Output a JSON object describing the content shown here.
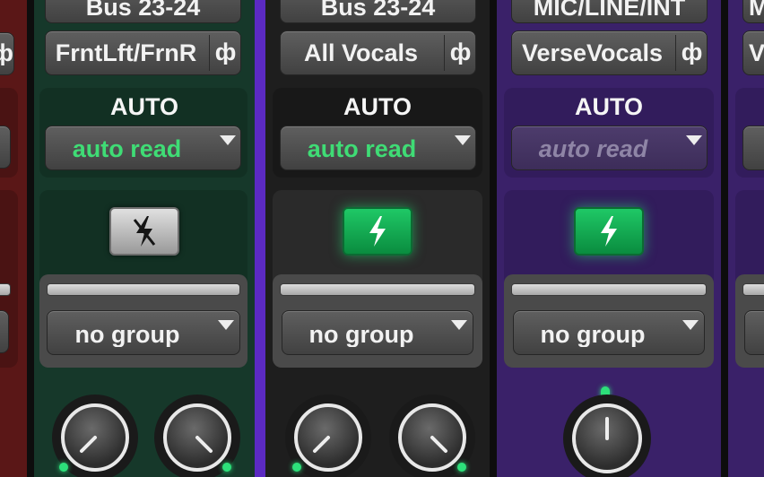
{
  "strips": {
    "s0": {
      "output": "",
      "auto_mode": "",
      "group": ""
    },
    "s1": {
      "bus": "Bus 23-24",
      "output": "FrntLft/FrnR",
      "auto_label": "AUTO",
      "auto_mode": "auto read",
      "group": "no group",
      "power_state": "off"
    },
    "s2": {
      "bus": "Bus 23-24",
      "output": "All Vocals",
      "auto_label": "AUTO",
      "auto_mode": "auto read",
      "group": "no group",
      "power_state": "on"
    },
    "s3": {
      "bus": "MIC/LINE/INT",
      "output": "VerseVocals",
      "auto_label": "AUTO",
      "auto_mode": "auto read",
      "group": "no group",
      "power_state": "on"
    },
    "s4": {
      "bus": "M",
      "output": "Vo",
      "auto_label": "",
      "auto_mode": "",
      "group": ""
    }
  },
  "colors": {
    "strip_red": "#5a1717",
    "strip_green": "#16382a",
    "strip_black": "#1e1e1e",
    "strip_purple": "#3a2169",
    "auto_read_active": "#3fdc75",
    "auto_read_inactive": "#8f85a6",
    "power_on": "#13b357"
  }
}
